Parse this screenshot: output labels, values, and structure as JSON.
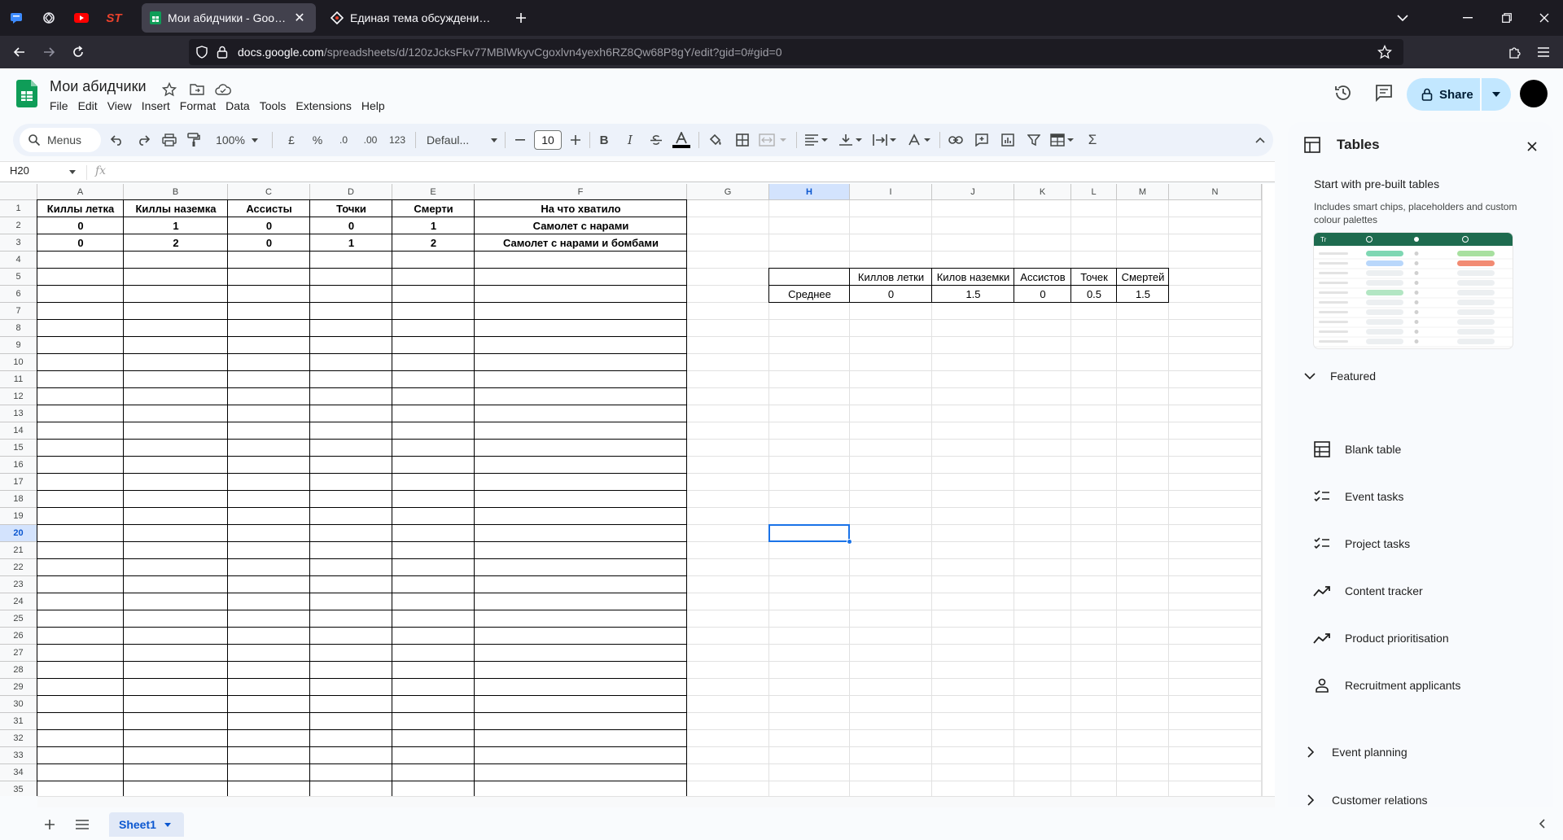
{
  "browser": {
    "tabs": [
      {
        "title": "Мои абидчики - Google Sheets",
        "active": true
      },
      {
        "title": "Единая тема обсуждения баланса",
        "active": false
      }
    ],
    "url_host": "docs.google.com",
    "url_rest": "/spreadsheets/d/120zJcksFkv77MBlWkyvCgoxlvn4yexh6RZ8Qw68P8gY/edit?gid=0#gid=0",
    "pinned_label_st": "ST"
  },
  "doc": {
    "title": "Мои абидчики",
    "menu": [
      "File",
      "Edit",
      "View",
      "Insert",
      "Format",
      "Data",
      "Tools",
      "Extensions",
      "Help"
    ],
    "share_label": "Share"
  },
  "toolbar": {
    "menus_label": "Menus",
    "zoom": "100%",
    "currency": "£",
    "percent": "%",
    "dec_decrease": ".0",
    "dec_increase": ".00",
    "number_format": "123",
    "font": "Defaul...",
    "font_size": "10",
    "bold": "B",
    "italic": "I",
    "sigma": "Σ"
  },
  "formula_bar": {
    "name_box": "H20",
    "fx": "fx"
  },
  "grid": {
    "columns": [
      "A",
      "B",
      "C",
      "D",
      "E",
      "F",
      "G",
      "H",
      "I",
      "J",
      "K",
      "L",
      "M",
      "N"
    ],
    "selected_column": "H",
    "selected_row": 20,
    "row_count": 35,
    "main_table": {
      "headers": [
        "Киллы летка",
        "Киллы наземка",
        "Ассисты",
        "Точки",
        "Смерти",
        "На что хватило"
      ],
      "rows": [
        [
          "0",
          "1",
          "0",
          "0",
          "1",
          "Самолет с нарами"
        ],
        [
          "0",
          "2",
          "0",
          "1",
          "2",
          "Самолет с нарами и бомбами"
        ]
      ]
    },
    "avg_table": {
      "headers": [
        "",
        "Киллов летки",
        "Килов наземки",
        "Ассистов",
        "Точек",
        "Смертей"
      ],
      "row": [
        "Среднее",
        "0",
        "1.5",
        "0",
        "0.5",
        "1.5"
      ]
    }
  },
  "sheets": {
    "tab": "Sheet1"
  },
  "side_panel": {
    "title": "Tables",
    "heading": "Start with pre-built tables",
    "description": "Includes smart chips, placeholders and custom colour palettes",
    "featured_label": "Featured",
    "items": [
      {
        "label": "Blank table",
        "icon": "table-icon"
      },
      {
        "label": "Event tasks",
        "icon": "checklist-icon"
      },
      {
        "label": "Project tasks",
        "icon": "checklist-icon"
      },
      {
        "label": "Content tracker",
        "icon": "trend-icon"
      },
      {
        "label": "Product prioritisation",
        "icon": "trend-icon"
      },
      {
        "label": "Recruitment applicants",
        "icon": "person-icon"
      }
    ],
    "sections": [
      "Event planning",
      "Customer relations"
    ]
  },
  "colors": {
    "accent": "#1a73e8",
    "share_bg": "#c2e7ff",
    "sheets_green": "#0f9d58"
  }
}
